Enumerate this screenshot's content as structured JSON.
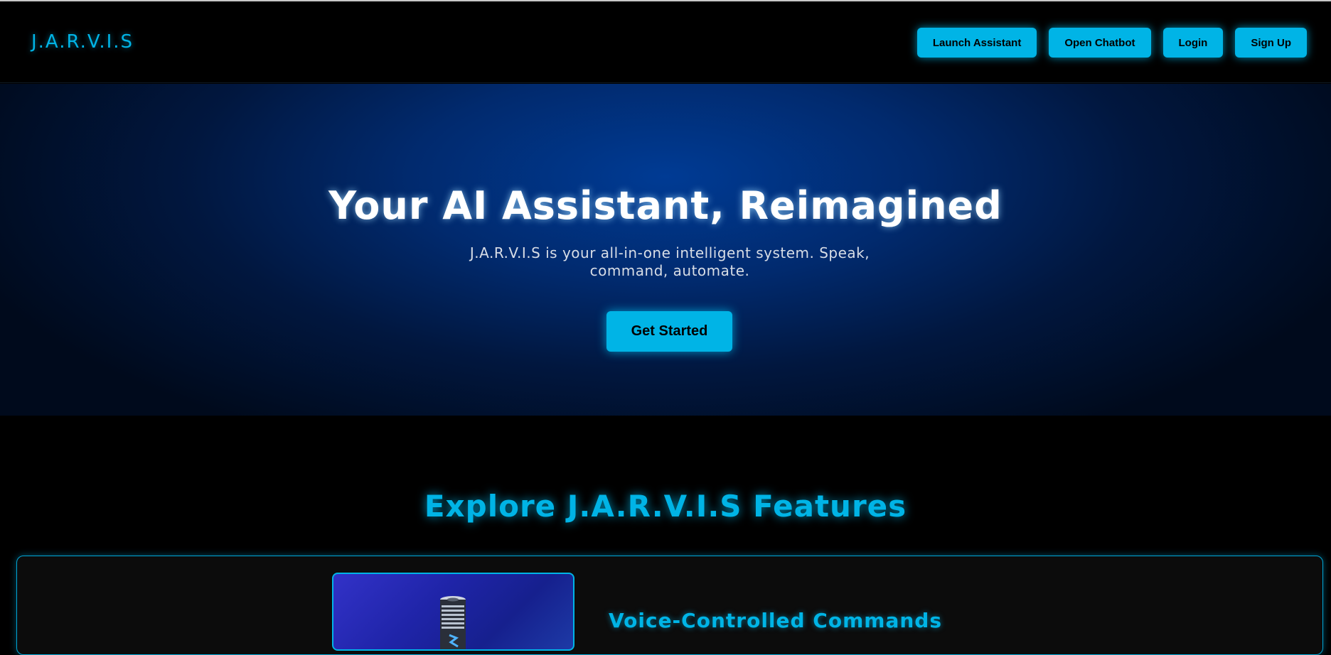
{
  "brand": {
    "logo_text": "J.A.R.V.I.S",
    "accent_color": "#00b4e6"
  },
  "nav": {
    "launch_assistant": "Launch Assistant",
    "open_chatbot": "Open Chatbot",
    "login": "Login",
    "sign_up": "Sign Up"
  },
  "hero": {
    "title": "Your AI Assistant, Reimagined",
    "subtitle": "J.A.R.V.I.S is your all-in-one intelligent system. Speak, command, automate.",
    "cta_label": "Get Started"
  },
  "features": {
    "title": "Explore J.A.R.V.I.S Features",
    "items": [
      {
        "heading": "Voice-Controlled Commands",
        "image_icon": "smart-speaker-device"
      }
    ]
  }
}
